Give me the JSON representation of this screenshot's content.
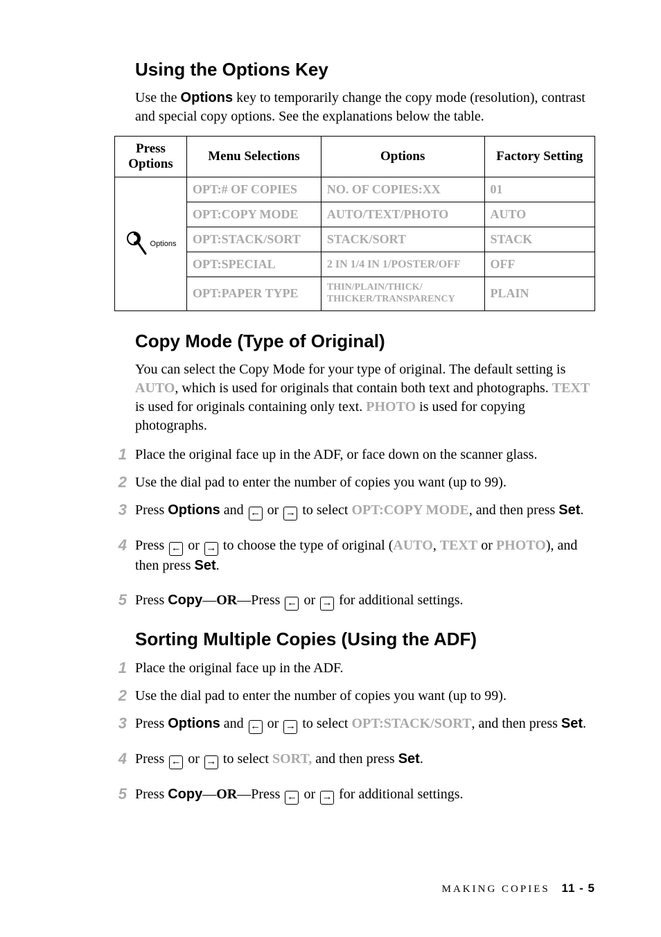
{
  "sections": {
    "using_options_key": {
      "heading": "Using the Options Key",
      "intro_prefix": "Use the ",
      "intro_key": "Options",
      "intro_suffix": " key to temporarily change the copy mode (resolution), contrast and special copy options. See the explanations below the table."
    },
    "copy_mode": {
      "heading": "Copy Mode (Type of Original)",
      "intro_1": "You can select the Copy Mode for your type of original. The default setting is ",
      "intro_auto": "AUTO",
      "intro_2": ", which is used for originals that contain both text and photographs. ",
      "intro_text": "TEXT",
      "intro_3": " is used for originals containing only text. ",
      "intro_photo": "PHOTO",
      "intro_4": " is used for copying photographs."
    },
    "sorting": {
      "heading": "Sorting Multiple Copies (Using the ADF)"
    }
  },
  "table": {
    "headers": {
      "col1_line1": "Press",
      "col1_line2": "Options",
      "col2": "Menu Selections",
      "col3": "Options",
      "col4": "Factory Setting"
    },
    "icon_label": "Options",
    "rows": [
      {
        "menu": "OPT:# OF COPIES",
        "options": "NO. OF COPIES:XX",
        "factory": "01",
        "small": false
      },
      {
        "menu": "OPT:COPY MODE",
        "options": "AUTO/TEXT/PHOTO",
        "factory": "AUTO",
        "small": false
      },
      {
        "menu": "OPT:STACK/SORT",
        "options": "STACK/SORT",
        "factory": "STACK",
        "small": false
      },
      {
        "menu": "OPT:SPECIAL",
        "options": "2 IN 1/4 IN 1/POSTER/OFF",
        "factory": "OFF",
        "small": true
      },
      {
        "menu": "OPT:PAPER TYPE",
        "options": "THIN/PLAIN/THICK/\nTHICKER/TRANSPARENCY",
        "factory": "PLAIN",
        "tiny": true
      }
    ]
  },
  "steps_copy_mode": {
    "s1": "Place the original face up in the ADF, or face down on the scanner glass.",
    "s2": "Use the dial pad to enter the number of copies you want (up to 99).",
    "s3_a": "Press ",
    "s3_options": "Options",
    "s3_b": " and ",
    "s3_c": " or ",
    "s3_d": "  to select ",
    "s3_opt": "OPT:COPY MODE",
    "s3_e": ", and then press ",
    "s3_set": "Set",
    "s3_f": ".",
    "s4_a": "Press ",
    "s4_b": " or ",
    "s4_c": "  to choose the type of original (",
    "s4_auto": "AUTO",
    "s4_comma1": ", ",
    "s4_text": "TEXT",
    "s4_or": " or ",
    "s4_photo": "PHOTO",
    "s4_d": "), and then press ",
    "s4_set": "Set",
    "s4_e": ".",
    "s5_a": "Press ",
    "s5_copy": "Copy",
    "s5_b": "—",
    "s5_or": "OR",
    "s5_c": "—Press ",
    "s5_d": " or ",
    "s5_e": "  for additional settings."
  },
  "steps_sorting": {
    "s1": "Place the original face up in the ADF.",
    "s2": "Use the dial pad to enter the number of copies you want (up to 99).",
    "s3_a": "Press ",
    "s3_options": "Options",
    "s3_b": " and ",
    "s3_c": " or ",
    "s3_d": "  to select ",
    "s3_opt": "OPT:STACK/SORT",
    "s3_e": ", and then press ",
    "s3_set": "Set",
    "s3_f": ".",
    "s4_a": "Press ",
    "s4_b": " or ",
    "s4_c": "  to select ",
    "s4_sort": "SORT,",
    "s4_d": " and then press ",
    "s4_set": "Set",
    "s4_e": ".",
    "s5_a": "Press ",
    "s5_copy": "Copy",
    "s5_b": "—",
    "s5_or": "OR",
    "s5_c": "—Press ",
    "s5_d": " or ",
    "s5_e": "  for additional settings."
  },
  "footer": {
    "label": "MAKING COPIES",
    "page": "11 - 5"
  },
  "glyphs": {
    "left_arrow": "←",
    "right_arrow": "→"
  }
}
